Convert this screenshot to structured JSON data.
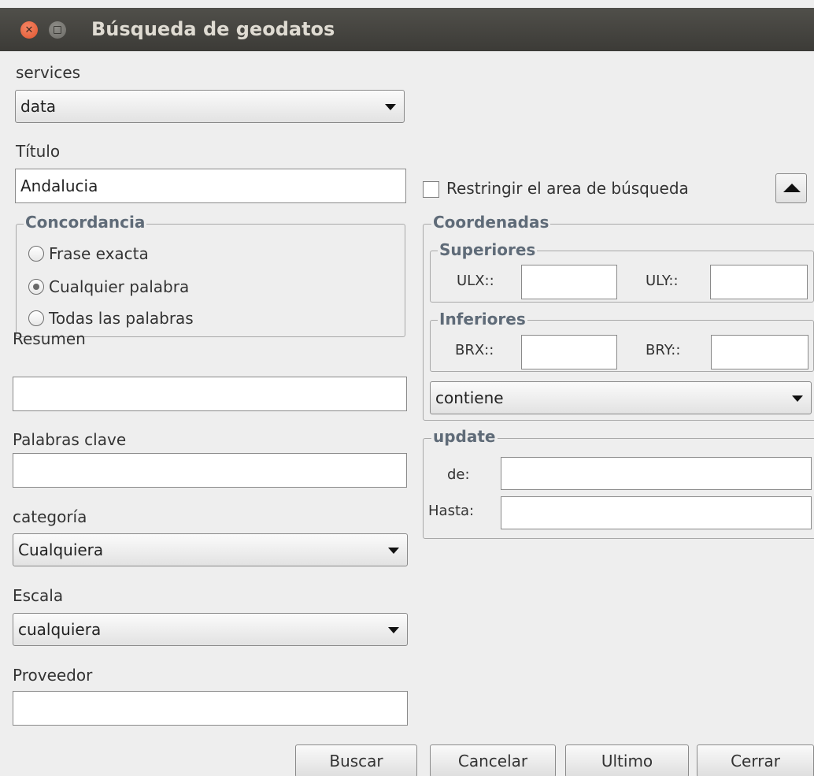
{
  "window": {
    "title": "Búsqueda de geodatos"
  },
  "services": {
    "label": "services",
    "selected": "data"
  },
  "titulo": {
    "label": "Título",
    "value": "Andalucia"
  },
  "restrict": {
    "label": "Restringir el area de búsqueda",
    "checked": false
  },
  "concordancia": {
    "title": "Concordancia",
    "options": [
      "Frase exacta",
      "Cualquier palabra",
      "Todas las palabras"
    ],
    "selected_index": 1
  },
  "coordenadas": {
    "title": "Coordenadas",
    "superiores": {
      "title": "Superiores",
      "ulx_label": "ULX::",
      "uly_label": "ULY::",
      "ulx_value": "",
      "uly_value": ""
    },
    "inferiores": {
      "title": "Inferiores",
      "brx_label": "BRX::",
      "bry_label": "BRY::",
      "brx_value": "",
      "bry_value": ""
    },
    "relation_selected": "contiene"
  },
  "resumen": {
    "label": "Resumen",
    "value": ""
  },
  "palabras_clave": {
    "label": "Palabras clave",
    "value": ""
  },
  "update": {
    "title": "update",
    "de_label": "de:",
    "hasta_label": "Hasta:",
    "de_value": "",
    "hasta_value": ""
  },
  "categoria": {
    "label": "categoría",
    "selected": "Cualquiera"
  },
  "escala": {
    "label": "Escala",
    "selected": "cualquiera"
  },
  "proveedor": {
    "label": "Proveedor",
    "value": ""
  },
  "buttons": {
    "buscar": "Buscar",
    "cancelar": "Cancelar",
    "ultimo": "Ultimo",
    "cerrar": "Cerrar"
  }
}
